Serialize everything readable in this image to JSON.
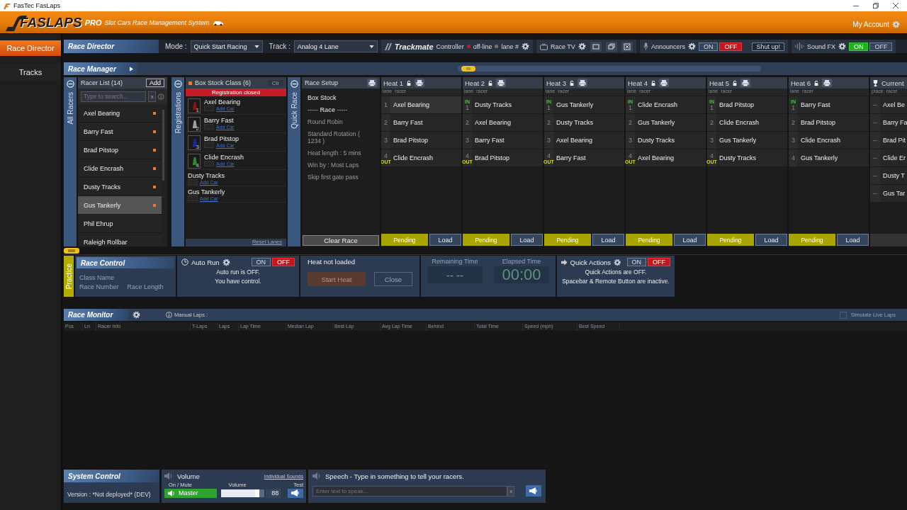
{
  "window": {
    "title": "FasTec FasLaps"
  },
  "header": {
    "logo": "FASLAPS",
    "edition": "PRO",
    "subtitle": "Slot Cars Race Management System",
    "account": "My Account"
  },
  "sidebar": {
    "items": [
      {
        "label": "Race Director",
        "selected": true
      },
      {
        "label": "Tracks",
        "selected": false
      }
    ]
  },
  "toolbar": {
    "title": "Race Director",
    "mode_label": "Mode :",
    "mode": "Quick Start Racing",
    "track_label": "Track :",
    "track": "Analog 4 Lane",
    "trackmate": "Trackmate",
    "trackmate_suffix": "Controller",
    "status": "off-line",
    "lane": "lane #",
    "race_tv": "Race TV",
    "announcers": {
      "label": "Announcers",
      "on_label": "ON",
      "off_label": "OFF",
      "on": false
    },
    "shut_up": "Shut up!",
    "sound_fx": {
      "label": "Sound FX",
      "on_label": "ON",
      "off_label": "OFF",
      "on": true
    }
  },
  "race_manager": {
    "title": "Race Manager"
  },
  "racer_list": {
    "tab": "All Racers",
    "title": "Racer List (14)",
    "add": "Add",
    "placeholder": "Type to search...",
    "clear": "x",
    "racers": [
      {
        "name": "Axel Bearing",
        "registered": true,
        "selected": false
      },
      {
        "name": "Barry Fast",
        "registered": true,
        "selected": false
      },
      {
        "name": "Brad Pitstop",
        "registered": true,
        "selected": false
      },
      {
        "name": "Clide Encrash",
        "registered": true,
        "selected": false
      },
      {
        "name": "Dusty Tracks",
        "registered": true,
        "selected": false
      },
      {
        "name": "Gus Tankerly",
        "registered": true,
        "selected": true
      },
      {
        "name": "Phil Ehrup",
        "registered": false,
        "selected": false
      },
      {
        "name": "Raleigh Rollbar",
        "registered": false,
        "selected": false
      }
    ]
  },
  "registrations": {
    "tab": "Registrations",
    "title": "Box Stock Class (6)",
    "clear": "Clr",
    "status": "Registration closed",
    "reset": "Reset Lanes",
    "entries": [
      {
        "name": "Axel Bearing",
        "lane": "1",
        "color": "#8a1414",
        "link": "Add Car"
      },
      {
        "name": "Barry Fast",
        "lane": "2",
        "color": "#a0a0a0",
        "link": "Add Car"
      },
      {
        "name": "Brad Pitstop",
        "lane": "3",
        "color": "#1c2a90",
        "link": "Add Car"
      },
      {
        "name": "Clide Encrash",
        "lane": "4",
        "color": "#2a8a2a",
        "link": "Add Car"
      },
      {
        "name": "Dusty Tracks",
        "link": "Add Car"
      },
      {
        "name": "Gus Tankerly",
        "link": "Add Car"
      }
    ]
  },
  "race_setup": {
    "tab": "Quick Race",
    "title": "Race Setup",
    "class": "Box Stock",
    "race_line": "----- **Race** -----",
    "lines": [
      "Round Robin",
      "Standard  Rotation ( 1234 )",
      "Heat length : 5 mins",
      "Win by : Most Laps",
      "Skip first gate pass"
    ],
    "clear": "Clear Race"
  },
  "heats": [
    {
      "title": "Heat 1",
      "lane_header": "lane",
      "racer_header": "racer",
      "status": "Pending",
      "load": "Load",
      "rows": [
        {
          "lane": "1",
          "racer": "Axel Bearing"
        },
        {
          "lane": "2",
          "racer": "Barry Fast"
        },
        {
          "lane": "3",
          "racer": "Brad Pitstop"
        },
        {
          "lane": "4",
          "racer": "Clide Encrash",
          "tag": "OUT"
        }
      ]
    },
    {
      "title": "Heat 2",
      "lane_header": "lane",
      "racer_header": "racer",
      "status": "Pending",
      "load": "Load",
      "rows": [
        {
          "lane": "1",
          "racer": "Dusty Tracks",
          "tag": "IN"
        },
        {
          "lane": "2",
          "racer": "Axel Bearing"
        },
        {
          "lane": "3",
          "racer": "Barry Fast"
        },
        {
          "lane": "4",
          "racer": "Brad Pitstop",
          "tag": "OUT"
        }
      ]
    },
    {
      "title": "Heat 3",
      "lane_header": "lane",
      "racer_header": "racer",
      "status": "Pending",
      "load": "Load",
      "rows": [
        {
          "lane": "1",
          "racer": "Gus Tankerly",
          "tag": "IN"
        },
        {
          "lane": "2",
          "racer": "Dusty Tracks"
        },
        {
          "lane": "3",
          "racer": "Axel Bearing"
        },
        {
          "lane": "4",
          "racer": "Barry Fast",
          "tag": "OUT"
        }
      ]
    },
    {
      "title": "Heat 4",
      "lane_header": "lane",
      "racer_header": "racer",
      "status": "Pending",
      "load": "Load",
      "rows": [
        {
          "lane": "1",
          "racer": "Clide Encrash",
          "tag": "IN"
        },
        {
          "lane": "2",
          "racer": "Gus Tankerly"
        },
        {
          "lane": "3",
          "racer": "Dusty Tracks"
        },
        {
          "lane": "4",
          "racer": "Axel Bearing",
          "tag": "OUT"
        }
      ]
    },
    {
      "title": "Heat 5",
      "lane_header": "lane",
      "racer_header": "racer",
      "status": "Pending",
      "load": "Load",
      "rows": [
        {
          "lane": "1",
          "racer": "Brad Pitstop",
          "tag": "IN"
        },
        {
          "lane": "2",
          "racer": "Clide Encrash"
        },
        {
          "lane": "3",
          "racer": "Gus Tankerly"
        },
        {
          "lane": "4",
          "racer": "Dusty Tracks",
          "tag": "OUT"
        }
      ]
    },
    {
      "title": "Heat 6",
      "lane_header": "lane",
      "racer_header": "racer",
      "status": "Pending",
      "load": "Load",
      "rows": [
        {
          "lane": "1",
          "racer": "Barry Fast",
          "tag": "IN"
        },
        {
          "lane": "2",
          "racer": "Brad Pitstop"
        },
        {
          "lane": "3",
          "racer": "Clide Encrash"
        },
        {
          "lane": "4",
          "racer": "Gus Tankerly"
        }
      ]
    }
  ],
  "current": {
    "title": "Current",
    "place_header": "place",
    "racer_header": "racer",
    "rows": [
      {
        "place": "--",
        "racer": "Axel Be"
      },
      {
        "place": "--",
        "racer": "Barry Fa"
      },
      {
        "place": "--",
        "racer": "Brad Pit"
      },
      {
        "place": "--",
        "racer": "Clide Er"
      },
      {
        "place": "--",
        "racer": "Dusty T"
      },
      {
        "place": "--",
        "racer": "Gus Tar"
      }
    ]
  },
  "race_control": {
    "title": "Race Control",
    "practice": "Practice",
    "class_name": "Class Name",
    "race_number": "Race Number",
    "race_length": "Race Length"
  },
  "auto_run": {
    "label": "Auto Run",
    "toggle": {
      "on_label": "ON",
      "off_label": "OFF",
      "on": false
    },
    "lines": [
      "Auto run is OFF.",
      "You have control."
    ]
  },
  "heat_control": {
    "status": "Heat not loaded",
    "start": "Start Heat",
    "close": "Close",
    "disabled": true
  },
  "timers": {
    "remaining_label": "Remaining Time",
    "remaining": "-- --",
    "elapsed_label": "Elapsed Time",
    "elapsed": "00:00"
  },
  "quick_actions": {
    "label": "Quick Actions",
    "toggle": {
      "on_label": "ON",
      "off_label": "OFF",
      "on": false
    },
    "lines": [
      "Quick Actions are OFF.",
      "Spacebar & Remote Button are inactive."
    ]
  },
  "race_monitor": {
    "title": "Race Monitor",
    "manual_laps": "Manual Laps :",
    "simulate": {
      "label": "Simulate Live Laps",
      "checked": false
    },
    "columns": [
      "Pos",
      "Ln",
      "Racer Info",
      "T-Laps",
      "Laps",
      "Lap Time",
      "Median Lap",
      "Best Lap",
      "Avg Lap Time",
      "Behind",
      "Total Time",
      "Speed (mph)",
      "Best Speed"
    ]
  },
  "system_control": {
    "title": "System Control",
    "version": "Version : *Not deployed* (DEV)",
    "volume": {
      "title": "Volume",
      "individual": "Individual Sounds",
      "mute_label": "On / Mute",
      "volume_label": "Volume",
      "test_label": "Test",
      "master": "Master",
      "master_on": true,
      "reading": "88"
    },
    "speech": {
      "title": "Speech - Type in something to tell your racers.",
      "placeholder": "Enter text to speak...",
      "clear": "x"
    }
  }
}
